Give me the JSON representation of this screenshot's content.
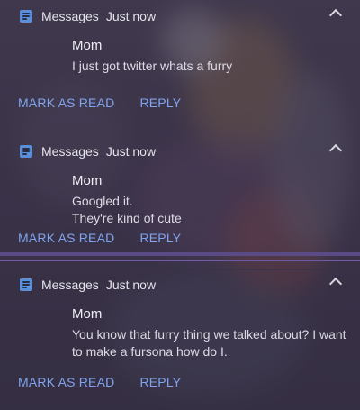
{
  "notifications": [
    {
      "app": "Messages",
      "time": "Just now",
      "sender": "Mom",
      "message": "I just got twitter whats a furry",
      "actions": {
        "mark_read": "MARK AS READ",
        "reply": "REPLY"
      },
      "icon": "message-icon"
    },
    {
      "app": "Messages",
      "time": "Just now",
      "sender": "Mom",
      "message": "Googled it.\nThey're kind of cute",
      "actions": {
        "mark_read": "MARK AS READ",
        "reply": "REPLY"
      },
      "icon": "message-icon"
    },
    {
      "app": "Messages",
      "time": "Just now",
      "sender": "Mom",
      "message": "You know that furry thing we talked about? I want to make a fursona how do I.",
      "actions": {
        "mark_read": "MARK AS READ",
        "reply": "REPLY"
      },
      "icon": "message-icon"
    }
  ],
  "colors": {
    "accent": "#7ea4ee",
    "app_icon": "#5b8fd9",
    "divider": "#5a4a86"
  }
}
